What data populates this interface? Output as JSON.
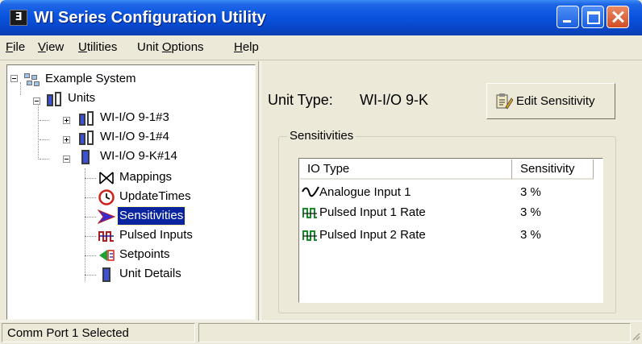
{
  "window": {
    "title": "WI Series Configuration Utility",
    "icon": "app-icon",
    "icon_glyph": "Ǝ"
  },
  "menu": [
    {
      "first": "F",
      "rest": "ile"
    },
    {
      "first": "V",
      "rest": "iew"
    },
    {
      "first": "U",
      "rest": "tilities"
    },
    {
      "first": "",
      "mid_pre": "Unit ",
      "u": "O",
      "mid_post": "ptions"
    },
    {
      "first": "H",
      "rest": "elp"
    }
  ],
  "tree": {
    "root": "Example System",
    "units": "Units",
    "unit1": "WI-I/O 9-1#3",
    "unit2": "WI-I/O 9-1#4",
    "unit3": "WI-I/O 9-K#14",
    "children": [
      "Mappings",
      "UpdateTimes",
      "Sensitivities",
      "Pulsed Inputs",
      "Setpoints",
      "Unit Details"
    ],
    "selected": "Sensitivities"
  },
  "detail": {
    "unit_type_label": "Unit Type:",
    "unit_type_value": "WI-I/O 9-K",
    "edit_button": "Edit Sensitivity",
    "group_title": "Sensitivities",
    "columns": [
      "IO Type",
      "Sensitivity"
    ],
    "rows": [
      {
        "icon": "analogue-wave-icon",
        "name": "Analogue Input 1",
        "value": "3 %"
      },
      {
        "icon": "pulse-icon",
        "name": "Pulsed Input 1 Rate",
        "value": "3 %"
      },
      {
        "icon": "pulse-icon",
        "name": "Pulsed Input 2 Rate",
        "value": "3 %"
      }
    ]
  },
  "status": {
    "text": "Comm Port 1 Selected"
  },
  "colors": {
    "title_blue": "#0a54e0",
    "selection": "#0a24a0",
    "close_red": "#d24d25",
    "window_face": "#ece9d8"
  }
}
